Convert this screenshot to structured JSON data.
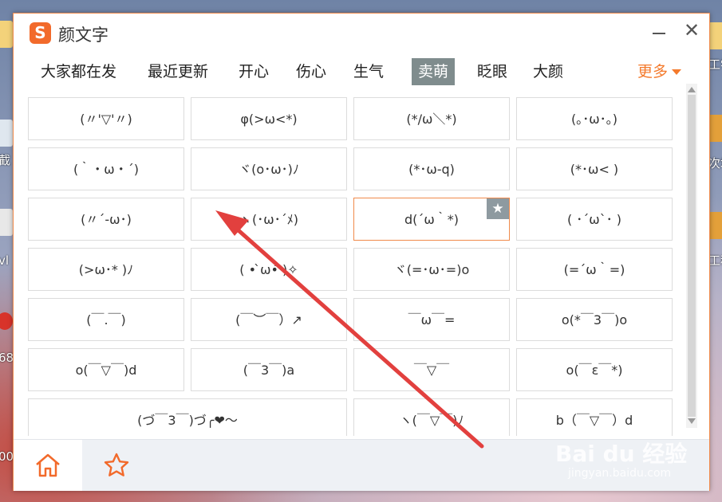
{
  "window": {
    "title": "颜文字",
    "logo_letter": "S",
    "minimize_label": "",
    "close_label": "✕"
  },
  "tabs": [
    {
      "label": "大家都在发",
      "active": false
    },
    {
      "label": "最近更新",
      "active": false
    },
    {
      "label": "开心",
      "active": false
    },
    {
      "label": "伤心",
      "active": false
    },
    {
      "label": "生气",
      "active": false
    },
    {
      "label": "卖萌",
      "active": true
    },
    {
      "label": "眨眼",
      "active": false
    },
    {
      "label": "大颜",
      "active": false
    }
  ],
  "more_label": "更多",
  "emoticons": [
    [
      "(〃'▽'〃)",
      "φ(>ω<*)",
      "(*/ω＼*)",
      "(｡･ω･｡)"
    ],
    [
      "(｀・ω・´)",
      "ヾ(o･ω･)ﾉ",
      "(*･ω-q)",
      "(*･ω< )"
    ],
    [
      "(〃´-ω･)",
      "ヽ(･ω･´ﾒ)",
      "d(´ω｀*)",
      "( ･´ω`･ )"
    ],
    [
      "(>ω･* )ﾉ",
      "( • ̀ω•́ )✧",
      "ヾ(=･ω･=)o",
      "(=´ω｀=)"
    ],
    [
      "(￣.￣)",
      "(￣︶￣）↗",
      "￣ω￣=",
      "o(*￣3￣)o"
    ],
    [
      "o(￣▽￣)d",
      "(￣3￣)a",
      "￣▽￣",
      "o(￣ε￣*)"
    ],
    [
      "(づ￣3￣)づ╭❤～",
      "",
      "ヽ(￣▽￣)ﾉ",
      "b（￣▽￣）d"
    ]
  ],
  "selected_cell": "d(´ω｀*)",
  "favorite_badge": "★",
  "bottom": {
    "home_icon": "home-icon",
    "favorites_icon": "star-icon"
  },
  "watermark": {
    "brand": "Bai du 经验",
    "url": "jingyan.baidu.com"
  },
  "desktop_labels": [
    "工学",
    "截",
    "vl",
    "68",
    "00",
    "次场",
    "工程"
  ],
  "colors": {
    "accent": "#f26a2b",
    "active_tab": "#7f8c8d",
    "arrow": "#e2403e"
  }
}
